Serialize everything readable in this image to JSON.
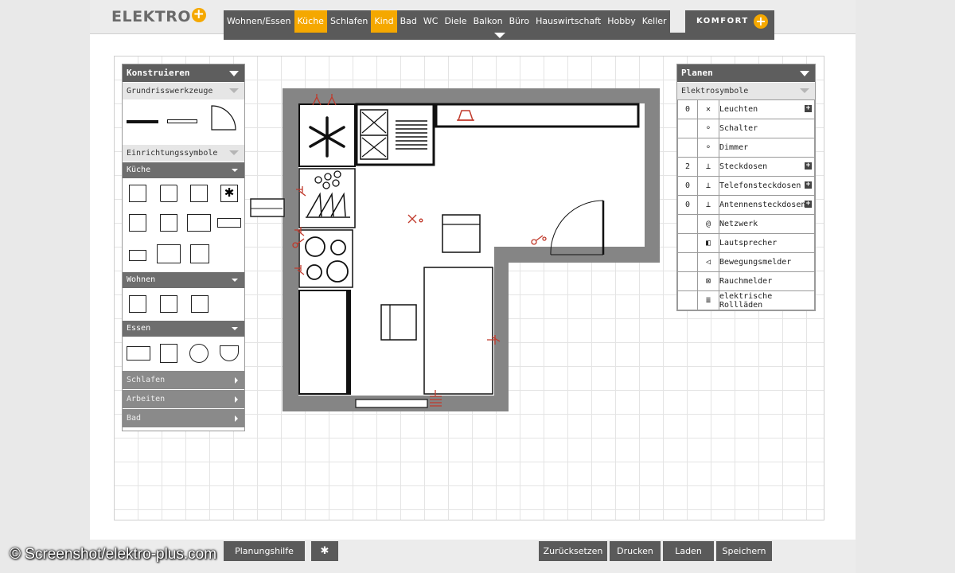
{
  "app": {
    "logo_text": "ELEKTRO",
    "logo_plus": "+"
  },
  "nav": {
    "tabs": [
      "Wohnen/Essen",
      "Küche",
      "Schlafen",
      "Kind",
      "Bad",
      "WC",
      "Diele",
      "Balkon",
      "Büro",
      "Hauswirtschaft",
      "Hobby",
      "Keller"
    ],
    "active_tabs": [
      "Küche",
      "Kind"
    ],
    "komfort_label": "KOMFORT",
    "komfort_plus": "+"
  },
  "left_panel": {
    "title": "Konstruieren",
    "grundriss_label": "Grundrisswerkzeuge",
    "einrichtung_label": "Einrichtungssymbole",
    "kueche_label": "Küche",
    "wohnen_label": "Wohnen",
    "essen_label": "Essen",
    "schlafen_label": "Schlafen",
    "arbeiten_label": "Arbeiten",
    "bad_label": "Bad"
  },
  "right_panel": {
    "title": "Planen",
    "subheader": "Elektrosymbole",
    "items": [
      {
        "count": "0",
        "label": "Leuchten",
        "icon": "light-x-icon",
        "expandable": true
      },
      {
        "count": "",
        "label": "Schalter",
        "icon": "switch-icon",
        "expandable": false
      },
      {
        "count": "",
        "label": "Dimmer",
        "icon": "dimmer-icon",
        "expandable": false
      },
      {
        "count": "2",
        "label": "Steckdosen",
        "icon": "socket-icon",
        "expandable": true
      },
      {
        "count": "0",
        "label": "Telefonsteckdosen",
        "icon": "phone-socket-icon",
        "expandable": true
      },
      {
        "count": "0",
        "label": "Antennensteckdosen",
        "icon": "antenna-socket-icon",
        "expandable": true
      },
      {
        "count": "",
        "label": "Netzwerk",
        "icon": "network-at-icon",
        "expandable": false
      },
      {
        "count": "",
        "label": "Lautsprecher",
        "icon": "speaker-icon",
        "expandable": false
      },
      {
        "count": "",
        "label": "Bewegungsmelder",
        "icon": "motion-sensor-icon",
        "expandable": false
      },
      {
        "count": "",
        "label": "Rauchmelder",
        "icon": "smoke-detector-icon",
        "expandable": false
      },
      {
        "count": "",
        "label": "elektrische Rollläden",
        "icon": "shutter-icon",
        "expandable": false
      }
    ],
    "plus_symbol": "+"
  },
  "bottom": {
    "planungshilfe": "Planungshilfe",
    "zuruecksetzen": "Zurücksetzen",
    "drucken": "Drucken",
    "laden": "Laden",
    "speichern": "Speichern"
  },
  "copyright": "© Screenshot/elektro-plus.com",
  "colors": {
    "accent": "#f5a800",
    "dark": "#5a5a5a",
    "electric_red": "#c0392b"
  }
}
